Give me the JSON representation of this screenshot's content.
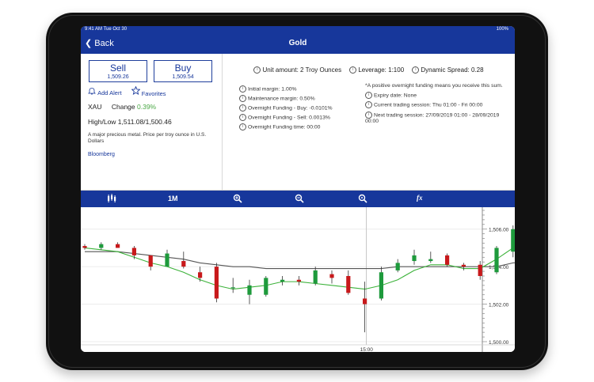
{
  "status": {
    "time": "9:41 AM",
    "date": "Tue Oct 30",
    "battery": "100%"
  },
  "nav": {
    "back": "Back",
    "title": "Gold"
  },
  "sell": {
    "label": "Sell",
    "price": "1,509.26"
  },
  "buy": {
    "label": "Buy",
    "price": "1,509.54"
  },
  "actions": {
    "alert": "Add Alert",
    "favorites": "Favorites"
  },
  "instrument": {
    "symbol": "XAU",
    "change_label": "Change",
    "change_value": "0.39%",
    "highlow": "High/Low  1,511.08/1,500.46",
    "description": "A major precious metal. Price per troy ounce in U.S. Dollars",
    "source": "Bloomberg"
  },
  "summary": {
    "unit": "Unit amount: 2 Troy Ounces",
    "leverage": "Leverage: 1:100",
    "spread": "Dynamic Spread: 0.28"
  },
  "details_left": [
    "Initial margin: 1.00%",
    "Maintenance margin: 0.50%",
    "Overnight Funding - Buy: -0.0101%",
    "Overnight Funding - Sell: 0.0013%",
    "Overnight Funding time: 00:00"
  ],
  "details_right": {
    "note": "*A positive overnight funding means you receive this sum.",
    "expiry": "Expiry date: None",
    "current": "Current trading session: Thu 01:00 - Fri 00:00",
    "next": "Next trading session: 27/09/2019 01:00 - 28/09/2019 00:00"
  },
  "toolbar": {
    "timeframe": "1M",
    "fx": "fx"
  },
  "colors": {
    "accent": "#17379b",
    "up": "#1e9a3c",
    "down": "#c8191b",
    "ma_green": "#3cb23a",
    "ma_gray": "#555555"
  },
  "icons": [
    "candles-icon",
    "zoom-in-icon",
    "zoom-out-icon",
    "zoom-reset-icon",
    "function-icon"
  ],
  "chart_data": {
    "type": "candlestick",
    "ylim": [
      1500.0,
      1507.0
    ],
    "ticks": [
      1500.0,
      1502.0,
      1504.0,
      1506.0
    ],
    "tick_labels": [
      "1,500.00",
      "1,502.00",
      "1,504.00",
      "1,506.00"
    ],
    "xlabel_marker": "15:00",
    "candles": [
      [
        1505.1,
        1505.2,
        1504.9,
        1505.0
      ],
      [
        1505.0,
        1505.3,
        1504.9,
        1505.2
      ],
      [
        1505.2,
        1505.3,
        1505.0,
        1505.0
      ],
      [
        1505.0,
        1505.1,
        1504.4,
        1504.6
      ],
      [
        1504.6,
        1504.6,
        1503.8,
        1504.0
      ],
      [
        1504.0,
        1504.9,
        1504.0,
        1504.7
      ],
      [
        1504.3,
        1504.8,
        1503.9,
        1504.0
      ],
      [
        1503.7,
        1504.0,
        1503.2,
        1503.4
      ],
      [
        1504.0,
        1504.2,
        1502.1,
        1502.3
      ],
      [
        1502.9,
        1503.4,
        1502.6,
        1502.9
      ],
      [
        1502.5,
        1503.3,
        1502.0,
        1503.0
      ],
      [
        1502.5,
        1503.5,
        1502.4,
        1503.4
      ],
      [
        1503.2,
        1503.5,
        1503.0,
        1503.3
      ],
      [
        1503.3,
        1503.5,
        1503.0,
        1503.2
      ],
      [
        1503.1,
        1504.0,
        1503.0,
        1503.8
      ],
      [
        1503.6,
        1503.8,
        1503.1,
        1503.4
      ],
      [
        1503.5,
        1503.8,
        1502.5,
        1502.6
      ],
      [
        1502.3,
        1503.2,
        1500.5,
        1502.0
      ],
      [
        1502.3,
        1504.0,
        1502.2,
        1503.7
      ],
      [
        1503.8,
        1504.4,
        1503.7,
        1504.2
      ],
      [
        1504.3,
        1504.9,
        1504.1,
        1504.6
      ],
      [
        1504.3,
        1504.8,
        1504.2,
        1504.4
      ],
      [
        1504.6,
        1504.7,
        1504.0,
        1504.1
      ],
      [
        1504.1,
        1504.2,
        1503.8,
        1504.0
      ],
      [
        1504.1,
        1504.3,
        1503.3,
        1503.5
      ],
      [
        1503.7,
        1505.1,
        1503.6,
        1505.0
      ],
      [
        1504.8,
        1506.2,
        1504.5,
        1506.0
      ],
      [
        1505.9,
        1506.2,
        1505.8,
        1506.0
      ],
      [
        1506.1,
        1506.2,
        1506.0,
        1506.1
      ],
      [
        1506.0,
        1506.6,
        1505.6,
        1506.0
      ]
    ],
    "ma_green": [
      1505.0,
      1504.9,
      1504.8,
      1504.5,
      1504.2,
      1504.0,
      1503.7,
      1503.3,
      1503.0,
      1502.8,
      1502.9,
      1503.0,
      1503.2,
      1503.2,
      1503.1,
      1503.0,
      1502.9,
      1502.8,
      1503.0,
      1503.3,
      1503.8,
      1504.1,
      1504.1,
      1503.9,
      1503.9,
      1504.4,
      1505.0,
      1505.6,
      1506.0,
      1506.0
    ],
    "ma_gray": [
      1504.8,
      1504.8,
      1504.8,
      1504.7,
      1504.6,
      1504.5,
      1504.4,
      1504.2,
      1504.1,
      1504.0,
      1504.0,
      1503.9,
      1503.9,
      1503.9,
      1503.9,
      1503.9,
      1503.9,
      1503.9,
      1503.9,
      1504.0,
      1504.0,
      1504.0,
      1504.0,
      1504.0,
      1504.0,
      1504.0,
      1504.2,
      1504.3,
      1504.4,
      1504.5
    ]
  }
}
